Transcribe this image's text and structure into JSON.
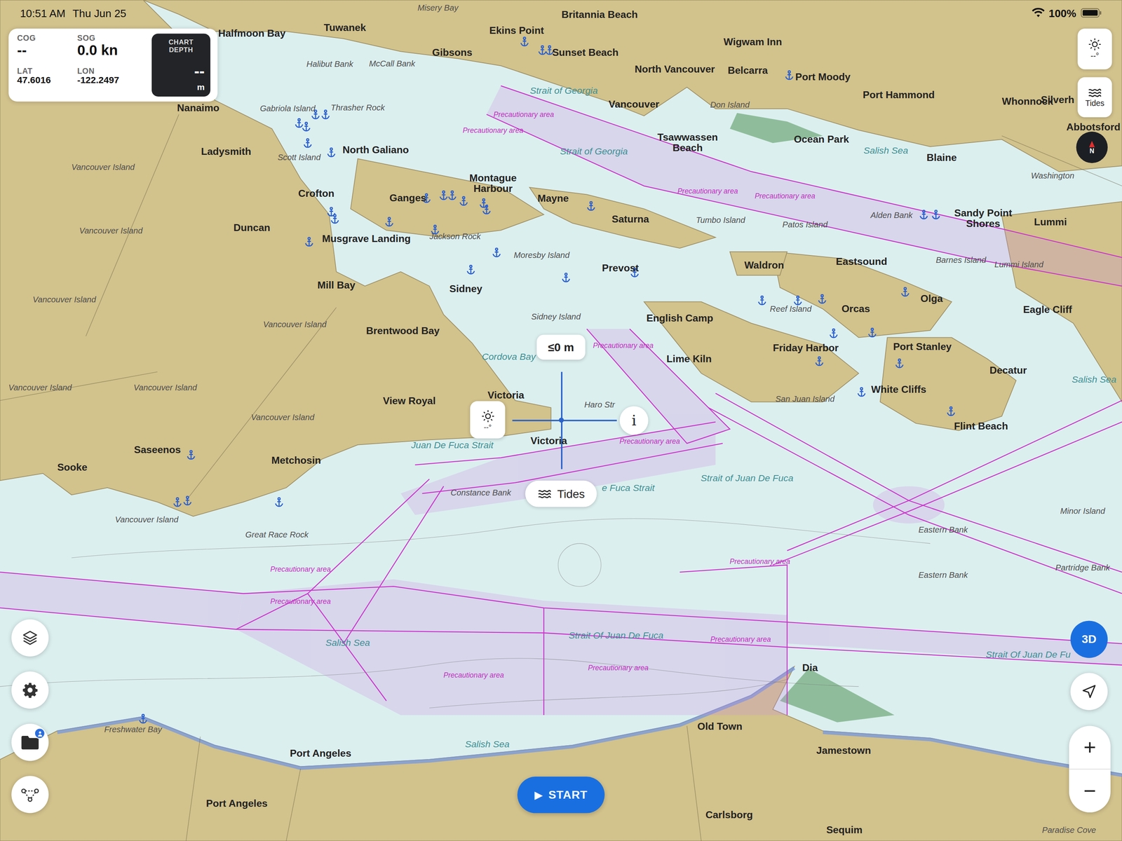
{
  "status_bar": {
    "time": "10:51 AM",
    "date": "Thu Jun 25",
    "battery": "100%"
  },
  "nav_panel": {
    "cog": {
      "label": "COG",
      "value": "--"
    },
    "sog": {
      "label": "SOG",
      "value": "0.0 kn"
    },
    "lat": {
      "label": "LAT",
      "value": "47.6016"
    },
    "lon": {
      "label": "LON",
      "value": "-122.2497"
    },
    "depth": {
      "label": "CHART DEPTH",
      "value": "--",
      "unit": "m"
    }
  },
  "right_controls": {
    "sun_reading": "--°",
    "tides": "Tides",
    "compass": "N",
    "view_3d": {
      "label": "3D",
      "selected": true
    },
    "zoom_in": "+",
    "zoom_out": "−"
  },
  "crosshair": {
    "depth": "≤0 m",
    "sun_reading": "--°",
    "info": "i",
    "tides": "Tides"
  },
  "start_button": {
    "icon": "▶",
    "label": "START"
  },
  "map_labels": [
    {
      "text": "Halfmoon Bay",
      "kind": "place"
    },
    {
      "text": "Tuwanek",
      "kind": "place"
    },
    {
      "text": "Ekins Point",
      "kind": "place"
    },
    {
      "text": "Britannia Beach",
      "kind": "place"
    },
    {
      "text": "Gibsons",
      "kind": "place"
    },
    {
      "text": "Sunset Beach",
      "kind": "place"
    },
    {
      "text": "Wigwam Inn",
      "kind": "place"
    },
    {
      "text": "North Vancouver",
      "kind": "place"
    },
    {
      "text": "Belcarra",
      "kind": "place"
    },
    {
      "text": "Port Moody",
      "kind": "place"
    },
    {
      "text": "Port Hammond",
      "kind": "place"
    },
    {
      "text": "Whonnock",
      "kind": "place"
    },
    {
      "text": "Silverh",
      "kind": "place"
    },
    {
      "text": "Abbotsford",
      "kind": "place"
    },
    {
      "text": "Vancouver",
      "kind": "place"
    },
    {
      "text": "Nanaimo",
      "kind": "place"
    },
    {
      "text": "Ladysmith",
      "kind": "place"
    },
    {
      "text": "North Galiano",
      "kind": "place"
    },
    {
      "text": "Tsawwassen Beach",
      "kind": "place"
    },
    {
      "text": "Ocean Park",
      "kind": "place"
    },
    {
      "text": "Blaine",
      "kind": "place"
    },
    {
      "text": "Crofton",
      "kind": "place"
    },
    {
      "text": "Montague Harbour",
      "kind": "place"
    },
    {
      "text": "Ganges",
      "kind": "place"
    },
    {
      "text": "Mayne",
      "kind": "place"
    },
    {
      "text": "Saturna",
      "kind": "place"
    },
    {
      "text": "Sandy Point Shores",
      "kind": "place"
    },
    {
      "text": "Lummi",
      "kind": "place"
    },
    {
      "text": "Duncan",
      "kind": "place"
    },
    {
      "text": "Musgrave Landing",
      "kind": "place"
    },
    {
      "text": "Waldron",
      "kind": "place"
    },
    {
      "text": "Eastsound",
      "kind": "place"
    },
    {
      "text": "Prevost",
      "kind": "place"
    },
    {
      "text": "Mill Bay",
      "kind": "place"
    },
    {
      "text": "Sidney",
      "kind": "place"
    },
    {
      "text": "Olga",
      "kind": "place"
    },
    {
      "text": "Eagle Cliff",
      "kind": "place"
    },
    {
      "text": "Orcas",
      "kind": "place"
    },
    {
      "text": "English Camp",
      "kind": "place"
    },
    {
      "text": "Brentwood Bay",
      "kind": "place"
    },
    {
      "text": "Friday Harbor",
      "kind": "place"
    },
    {
      "text": "Port Stanley",
      "kind": "place"
    },
    {
      "text": "Lime Kiln",
      "kind": "place"
    },
    {
      "text": "Decatur",
      "kind": "place"
    },
    {
      "text": "White Cliffs",
      "kind": "place"
    },
    {
      "text": "View Royal",
      "kind": "place"
    },
    {
      "text": "Victoria",
      "kind": "place"
    },
    {
      "text": "Victoria",
      "kind": "place"
    },
    {
      "text": "Flint Beach",
      "kind": "place"
    },
    {
      "text": "Saseenos",
      "kind": "place"
    },
    {
      "text": "Metchosin",
      "kind": "place"
    },
    {
      "text": "Sooke",
      "kind": "place"
    },
    {
      "text": "Dia",
      "kind": "place"
    },
    {
      "text": "Old Town",
      "kind": "place"
    },
    {
      "text": "Jamestown",
      "kind": "place"
    },
    {
      "text": "Port Angeles",
      "kind": "place"
    },
    {
      "text": "Port Angeles",
      "kind": "place"
    },
    {
      "text": "Carlsborg",
      "kind": "place"
    },
    {
      "text": "Sequim",
      "kind": "place"
    },
    {
      "text": "Vancouver Island",
      "kind": "region"
    },
    {
      "text": "Vancouver Island",
      "kind": "region"
    },
    {
      "text": "Vancouver Island",
      "kind": "region"
    },
    {
      "text": "Vancouver Island",
      "kind": "region"
    },
    {
      "text": "Vancouver Island",
      "kind": "region"
    },
    {
      "text": "Vancouver Island",
      "kind": "region"
    },
    {
      "text": "Vancouver Island",
      "kind": "region"
    },
    {
      "text": "Vancouver Island",
      "kind": "region"
    },
    {
      "text": "Washington",
      "kind": "region"
    },
    {
      "text": "San Juan Island",
      "kind": "region"
    },
    {
      "text": "Reef Island",
      "kind": "region"
    },
    {
      "text": "Jackson Rock",
      "kind": "region"
    },
    {
      "text": "Moresby Island",
      "kind": "region"
    },
    {
      "text": "Sidney Island",
      "kind": "region"
    },
    {
      "text": "Scott Island",
      "kind": "region"
    },
    {
      "text": "Gabriola Island",
      "kind": "region"
    },
    {
      "text": "Thrasher Rock",
      "kind": "region"
    },
    {
      "text": "Halibut Bank",
      "kind": "region"
    },
    {
      "text": "McCall Bank",
      "kind": "region"
    },
    {
      "text": "Misery Bay",
      "kind": "region"
    },
    {
      "text": "Don Island",
      "kind": "region"
    },
    {
      "text": "Tumbo Island",
      "kind": "region"
    },
    {
      "text": "Patos Island",
      "kind": "region"
    },
    {
      "text": "Alden Bank",
      "kind": "region"
    },
    {
      "text": "Barnes Island",
      "kind": "region"
    },
    {
      "text": "Lummi Island",
      "kind": "region"
    },
    {
      "text": "Great Race Rock",
      "kind": "region"
    },
    {
      "text": "Constance Bank",
      "kind": "region"
    },
    {
      "text": "Eastern Bank",
      "kind": "region"
    },
    {
      "text": "Eastern Bank",
      "kind": "region"
    },
    {
      "text": "Minor Island",
      "kind": "region"
    },
    {
      "text": "Partridge Bank",
      "kind": "region"
    },
    {
      "text": "Freshwater Bay",
      "kind": "region"
    },
    {
      "text": "Paradise Cove",
      "kind": "region"
    },
    {
      "text": "Haro Str",
      "kind": "region"
    },
    {
      "text": "Cordova Bay",
      "kind": "water"
    },
    {
      "text": "Strait of Georgia",
      "kind": "water"
    },
    {
      "text": "Strait of Georgia",
      "kind": "water"
    },
    {
      "text": "Salish Sea",
      "kind": "water"
    },
    {
      "text": "Salish Sea",
      "kind": "water"
    },
    {
      "text": "Salish Sea",
      "kind": "water"
    },
    {
      "text": "Salish Sea",
      "kind": "water"
    },
    {
      "text": "Juan De Fuca Strait",
      "kind": "water"
    },
    {
      "text": "e Fuca Strait",
      "kind": "water"
    },
    {
      "text": "Strait of Juan De Fuca",
      "kind": "water"
    },
    {
      "text": "Strait Of Juan De Fuca",
      "kind": "water"
    },
    {
      "text": "Strait Of Juan De Fu",
      "kind": "water"
    },
    {
      "text": "Precautionary area",
      "kind": "caution"
    },
    {
      "text": "Precautionary area",
      "kind": "caution"
    },
    {
      "text": "Precautionary area",
      "kind": "caution"
    },
    {
      "text": "Precautionary area",
      "kind": "caution"
    },
    {
      "text": "Precautionary area",
      "kind": "caution"
    },
    {
      "text": "Precautionary area",
      "kind": "caution"
    },
    {
      "text": "Precautionary area",
      "kind": "caution"
    },
    {
      "text": "Precautionary area",
      "kind": "caution"
    },
    {
      "text": "Precautionary area",
      "kind": "caution"
    },
    {
      "text": "Precautionary area",
      "kind": "caution"
    },
    {
      "text": "Precautionary area",
      "kind": "caution"
    },
    {
      "text": "Precautionary area",
      "kind": "caution"
    }
  ]
}
